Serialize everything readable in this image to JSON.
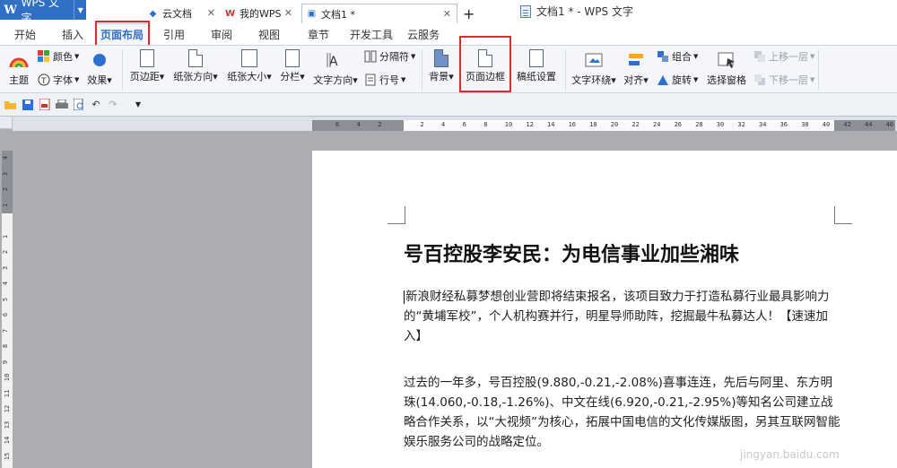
{
  "app": {
    "name": "WPS 文字",
    "window_title": "文档1 * - WPS 文字"
  },
  "ribbon_tabs": [
    {
      "label": "开始"
    },
    {
      "label": "插入"
    },
    {
      "label": "页面布局"
    },
    {
      "label": "引用"
    },
    {
      "label": "审阅"
    },
    {
      "label": "视图"
    },
    {
      "label": "章节"
    },
    {
      "label": "开发工具"
    },
    {
      "label": "云服务"
    }
  ],
  "ribbon": {
    "theme": "主题",
    "color": "颜色",
    "font": "字体",
    "effect": "效果",
    "margins": "页边距",
    "orientation": "纸张方向",
    "size": "纸张大小",
    "columns": "分栏",
    "text_direction": "文字方向",
    "separator": "分隔符",
    "line_numbers": "行号",
    "background": "背景",
    "page_border": "页面边框",
    "manuscript": "稿纸设置",
    "text_wrap": "文字环绕",
    "align": "对齐",
    "group": "组合",
    "rotate": "旋转",
    "selection_pane": "选择窗格",
    "bring_forward": "上移一层",
    "send_backward": "下移一层"
  },
  "doc_tabs": [
    {
      "label": "云文档"
    },
    {
      "label": "我的WPS"
    },
    {
      "label": "文档1 *"
    }
  ],
  "hruler_ticks": [
    "6",
    "4",
    "2",
    "",
    "2",
    "4",
    "6",
    "8",
    "10",
    "12",
    "14",
    "16",
    "18",
    "20",
    "22",
    "24",
    "26",
    "28",
    "30",
    "32",
    "34",
    "36",
    "38",
    "40",
    "42",
    "44",
    "46"
  ],
  "vruler_ticks": [
    "4",
    "3",
    "2",
    "1",
    "",
    "1",
    "2",
    "3",
    "4",
    "5",
    "6",
    "7",
    "8",
    "9",
    "10",
    "11",
    "12",
    "13",
    "14",
    "15"
  ],
  "document": {
    "heading": "号百控股李安民：为电信事业加些湘味",
    "paragraph1": "新浪财经私募梦想创业营即将结束报名，该项目致力于打造私募行业最具影响力的“黄埔军校”，个人机构赛并行，明星导师助阵，挖掘最牛私募达人！【速速加入】",
    "paragraph2": "过去的一年多，号百控股(9.880,-0.21,-2.08%)喜事连连，先后与阿里、东方明珠(14.060,-0.18,-1.26%)、中文在线(6.920,-0.21,-2.95%)等知名公司建立战略合作关系，以“大视频”为核心，拓展中国电信的文化传媒版图，另其互联网智能娱乐服务公司的战略定位。"
  },
  "watermark": "jingyan.baidu.com"
}
